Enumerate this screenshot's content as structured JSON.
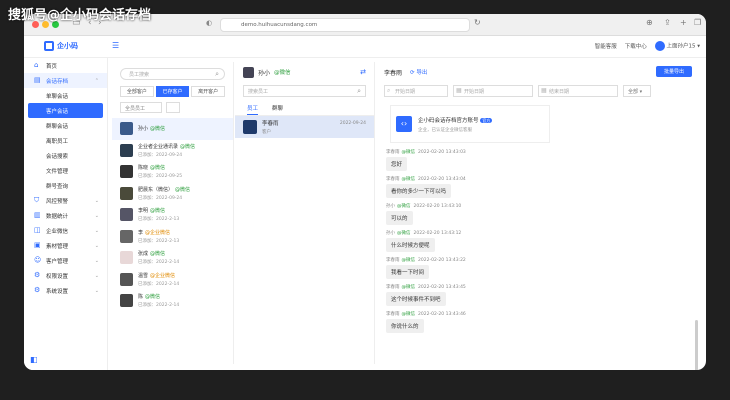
{
  "watermark": "搜狐号@企小码会话存档",
  "browser": {
    "url": "demo.huihuacunsdang.com"
  },
  "header": {
    "logo": "企小码",
    "right_items": [
      "智能客服",
      "下载中心",
      "上面孙户15"
    ]
  },
  "sidebar": {
    "items": [
      {
        "label": "首页",
        "type": "top"
      },
      {
        "label": "会话存档",
        "type": "parent-active"
      },
      {
        "label": "单聊会话",
        "type": "sub"
      },
      {
        "label": "客户会话",
        "type": "sub-active"
      },
      {
        "label": "群聊会话",
        "type": "sub"
      },
      {
        "label": "离职员工",
        "type": "sub"
      },
      {
        "label": "会话搜索",
        "type": "sub"
      },
      {
        "label": "文件管理",
        "type": "sub"
      },
      {
        "label": "群号查询",
        "type": "sub"
      },
      {
        "label": "风控预警",
        "type": "top"
      },
      {
        "label": "数据统计",
        "type": "top"
      },
      {
        "label": "企业微信",
        "type": "top"
      },
      {
        "label": "素材管理",
        "type": "top"
      },
      {
        "label": "客户管理",
        "type": "top"
      },
      {
        "label": "权限设置",
        "type": "top"
      },
      {
        "label": "系统设置",
        "type": "top"
      }
    ]
  },
  "contacts_panel": {
    "search_placeholder": "员工搜索",
    "tabs": [
      "全部客户",
      "已存客户",
      "离开客户"
    ],
    "filter1": "全员员工",
    "contacts": [
      {
        "name": "孙小",
        "tag": "@微信",
        "tag_color": "green",
        "sub": ""
      },
      {
        "name": "企业者企业通讯录",
        "tag": "@微信",
        "tag_color": "green",
        "sub": "已添加：2022-09-24"
      },
      {
        "name": "陈晓",
        "tag": "@微信",
        "tag_color": "green",
        "sub": "已添加：2022-09-25"
      },
      {
        "name": "肥晨东（微信）",
        "tag": "@微信",
        "tag_color": "green",
        "sub": "已添加：2022-09-24"
      },
      {
        "name": "李明",
        "tag": "@微信",
        "tag_color": "green",
        "sub": "已添加：2022-2-13"
      },
      {
        "name": "李",
        "tag": "@企业微信",
        "tag_color": "orange",
        "sub": "已添加：2022-2-13"
      },
      {
        "name": "张成",
        "tag": "@微信",
        "tag_color": "green",
        "sub": "已添加：2022-2-14"
      },
      {
        "name": "温雪",
        "tag": "@企业微信",
        "tag_color": "orange",
        "sub": "已添加：2022-2-14"
      },
      {
        "name": "陈",
        "tag": "@微信",
        "tag_color": "green",
        "sub": "已添加：2022-2-14"
      }
    ]
  },
  "middle_panel": {
    "name": "孙小",
    "badge": "@微信",
    "search_placeholder": "搜索员工",
    "tabs": [
      "员工",
      "群聊"
    ],
    "row_name": "李春雨",
    "row_sub": "客户",
    "row_time": "2022-09-24"
  },
  "chat_panel": {
    "title": "李春雨",
    "download": "导出",
    "button": "批量导出",
    "filter1": "开始日期",
    "filter2": "开始日期",
    "filter3": "结束日期",
    "select": "全部",
    "card": {
      "title": "企小码会话存档官方账号",
      "pill": "官方",
      "sub": "企业，已认证企业微信客服"
    },
    "messages": [
      {
        "name": "李春雨",
        "status": "@微信",
        "time": "2022-02-20 13:43:03",
        "text": "您好"
      },
      {
        "name": "李春雨",
        "status": "@微信",
        "time": "2022-02-20 13:43:04",
        "text": "看你的多少一下可以吗"
      },
      {
        "name": "孙小",
        "status": "@微信",
        "time": "2022-02-20 13:43:10",
        "text": "可以的"
      },
      {
        "name": "孙小",
        "status": "@微信",
        "time": "2022-02-20 13:43:12",
        "text": "什么时候方便呢"
      },
      {
        "name": "李春雨",
        "status": "@微信",
        "time": "2022-02-20 13:43:22",
        "text": "我看一下时间"
      },
      {
        "name": "李春雨",
        "status": "@微信",
        "time": "2022-02-20 13:43:45",
        "text": "这个时候事件不到吧"
      },
      {
        "name": "李春雨",
        "status": "@微信",
        "time": "2022-02-20 13:43:46",
        "text": "你说什么的"
      }
    ]
  }
}
